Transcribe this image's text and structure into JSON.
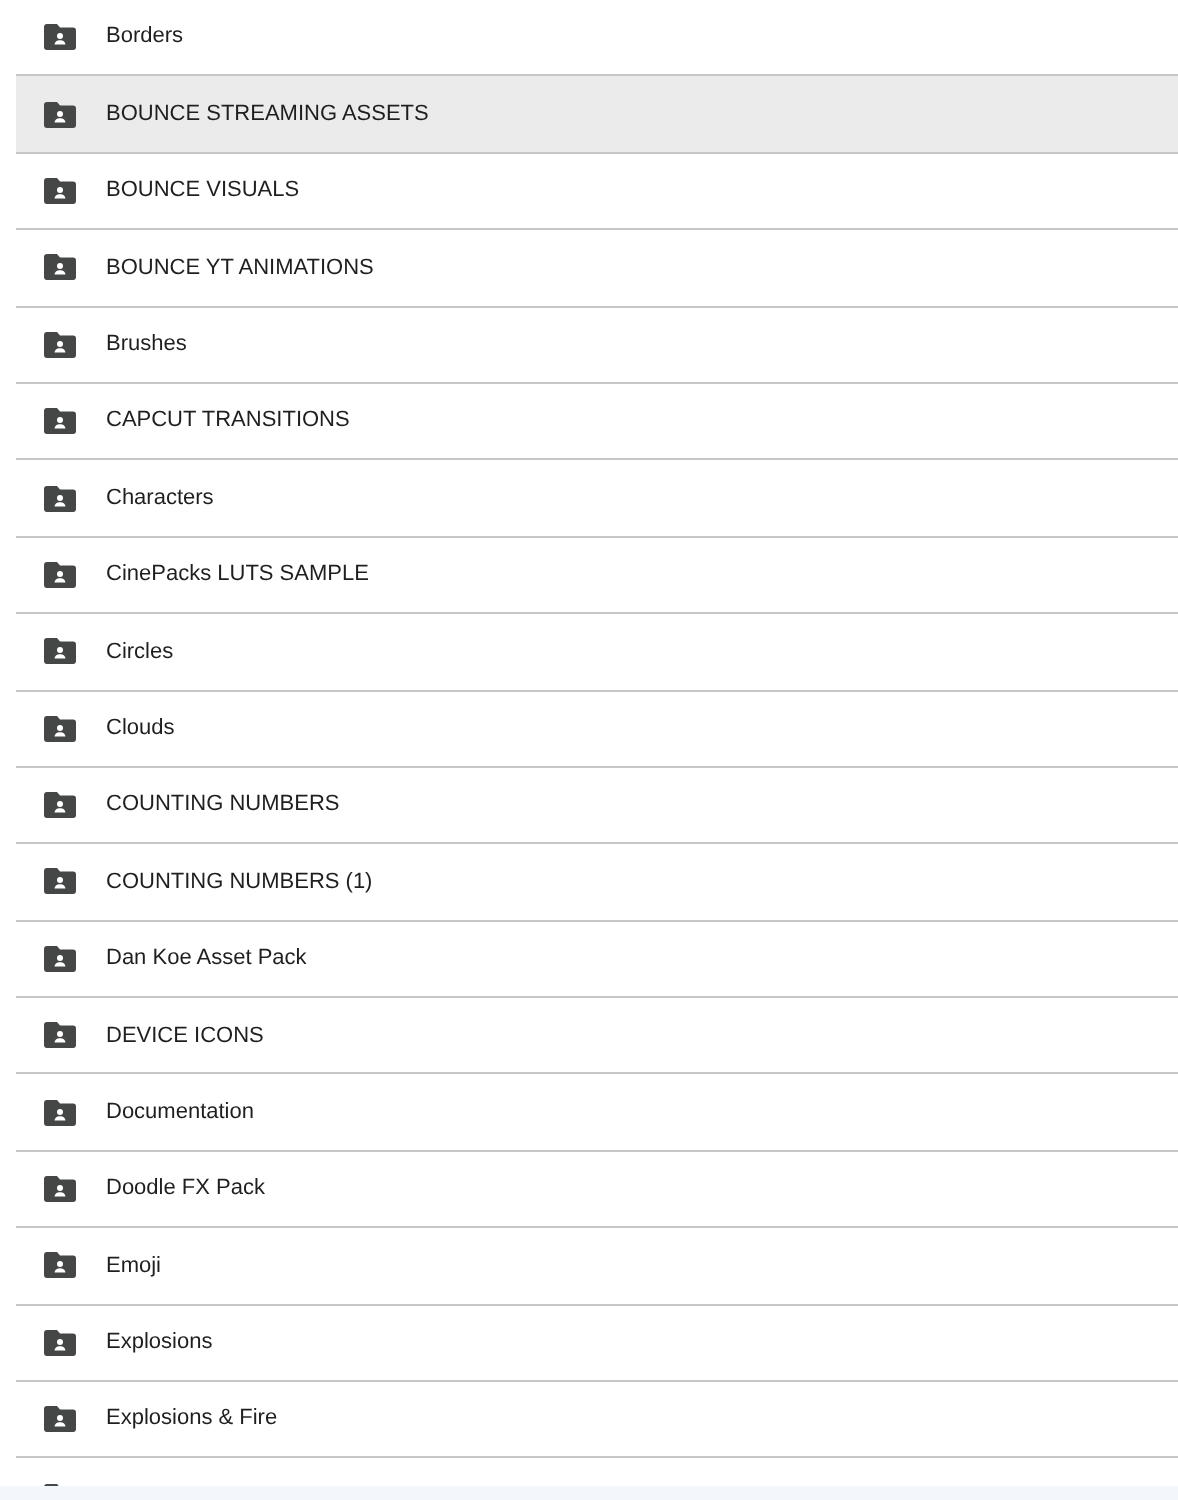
{
  "folders": [
    {
      "name": "Borders",
      "selected": false
    },
    {
      "name": "BOUNCE STREAMING ASSETS",
      "selected": true
    },
    {
      "name": "BOUNCE VISUALS",
      "selected": false
    },
    {
      "name": "BOUNCE YT ANIMATIONS",
      "selected": false
    },
    {
      "name": "Brushes",
      "selected": false
    },
    {
      "name": "CAPCUT TRANSITIONS",
      "selected": false
    },
    {
      "name": "Characters",
      "selected": false
    },
    {
      "name": "CinePacks LUTS SAMPLE",
      "selected": false
    },
    {
      "name": "Circles",
      "selected": false
    },
    {
      "name": "Clouds",
      "selected": false
    },
    {
      "name": "COUNTING NUMBERS",
      "selected": false
    },
    {
      "name": "COUNTING NUMBERS (1)",
      "selected": false
    },
    {
      "name": "Dan Koe Asset Pack",
      "selected": false
    },
    {
      "name": "DEVICE ICONS",
      "selected": false
    },
    {
      "name": "Documentation",
      "selected": false
    },
    {
      "name": "Doodle FX Pack",
      "selected": false
    },
    {
      "name": "Emoji",
      "selected": false
    },
    {
      "name": "Explosions",
      "selected": false
    },
    {
      "name": "Explosions & Fire",
      "selected": false
    }
  ]
}
